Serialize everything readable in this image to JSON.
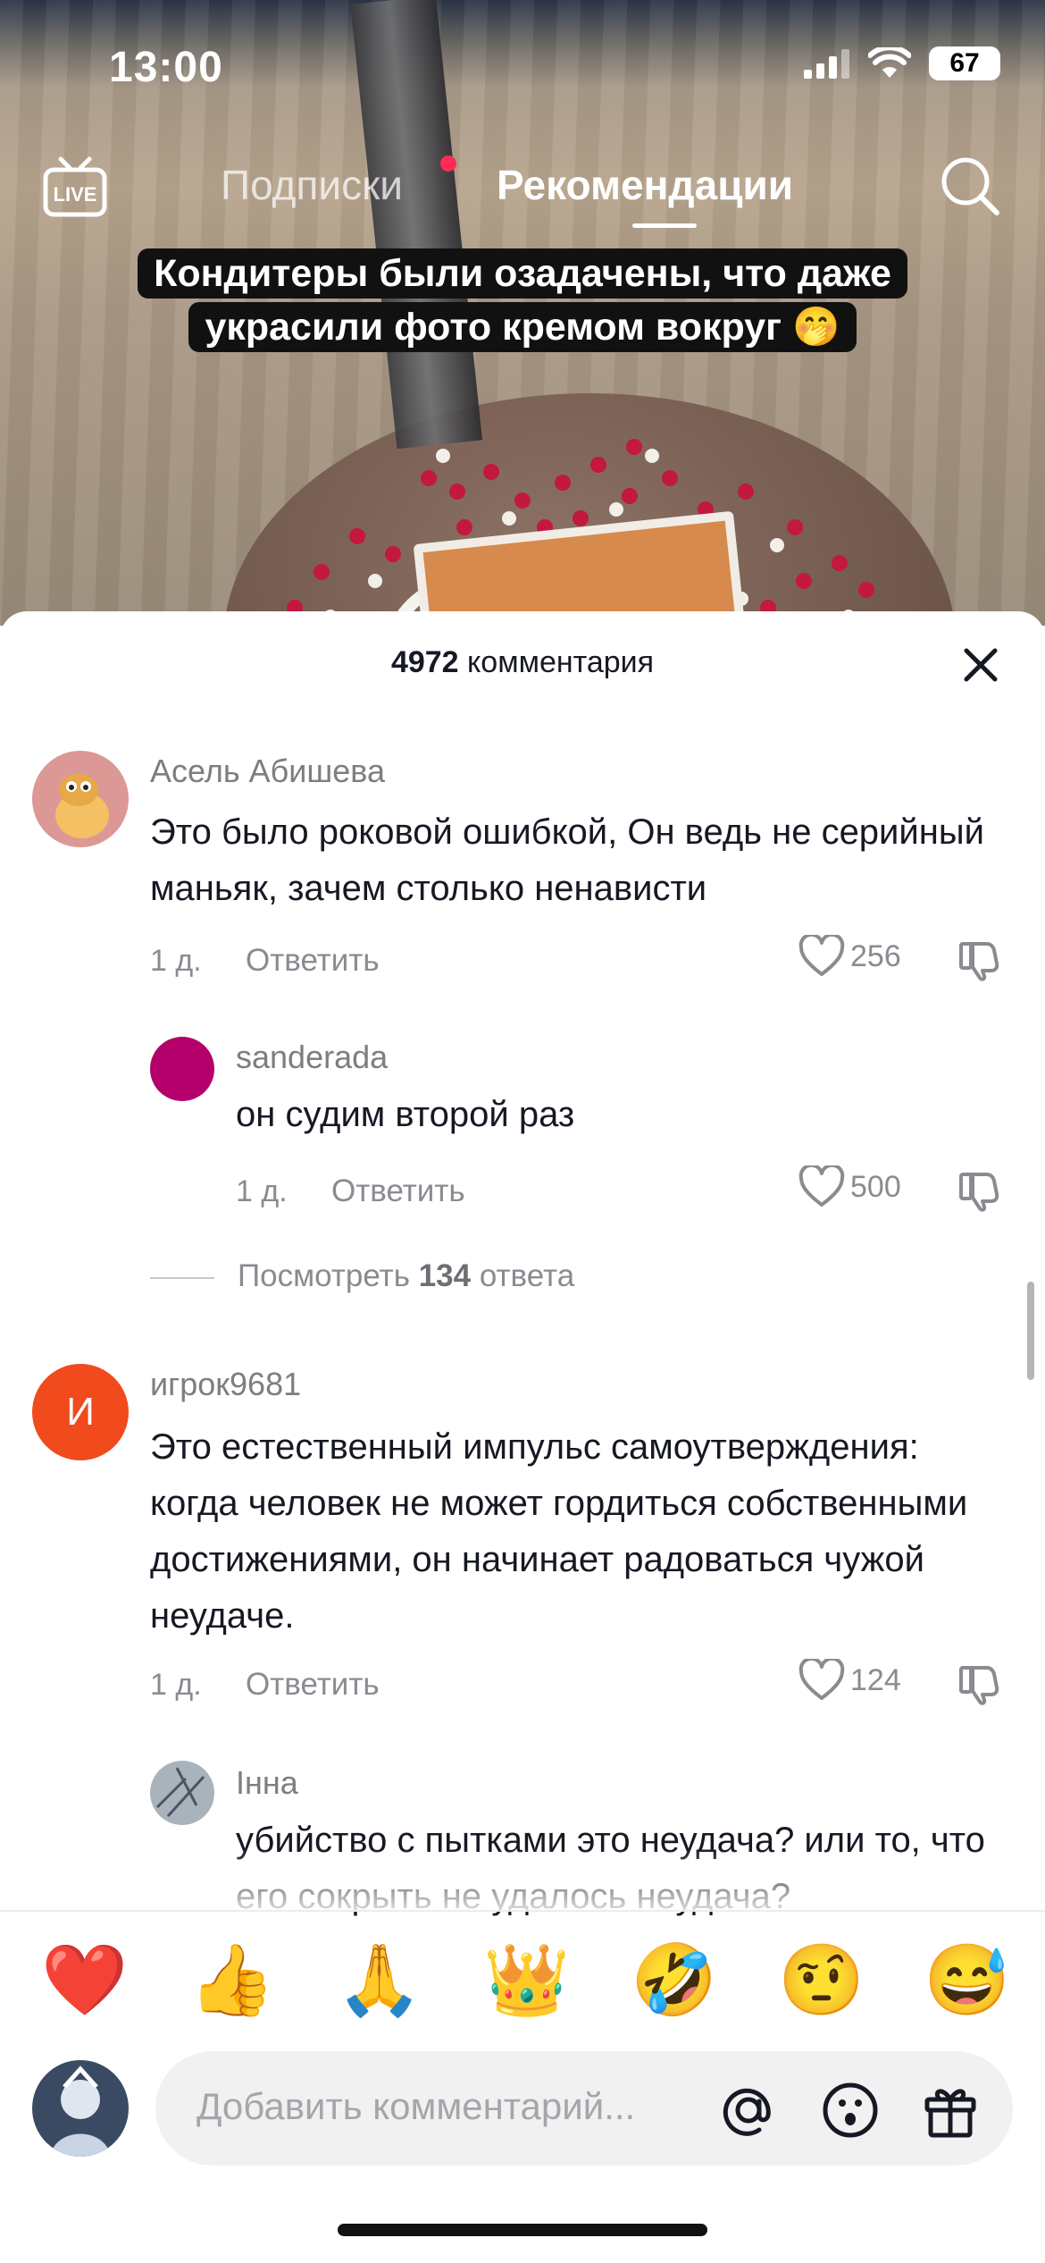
{
  "status_bar": {
    "time": "13:00",
    "battery": "67"
  },
  "top_nav": {
    "live_label": "LIVE",
    "tab_subscriptions": "Подписки",
    "tab_recommendations": "Рекомендации"
  },
  "video": {
    "caption_line1": "Кондитеры были озадачены, что даже",
    "caption_line2": "украсили фото кремом вокруг 🤭"
  },
  "comments_sheet": {
    "count": "4972",
    "count_label": "комментария",
    "comments": [
      {
        "username": "Асель Абишева",
        "text": "Это было роковой ошибкой, Он ведь не серийный маньяк, зачем столько ненависти",
        "time": "1 д.",
        "reply_label": "Ответить",
        "likes": "256"
      },
      {
        "username": "sanderada",
        "text": "он судим второй раз",
        "time": "1 д.",
        "reply_label": "Ответить",
        "likes": "500"
      },
      {
        "username": "игрок9681",
        "avatar_letter": "И",
        "text": "Это естественный импульс самоутверждения: когда человек не может гордиться собственными достижениями, он начинает радоваться чужой неудаче.",
        "time": "1 д.",
        "reply_label": "Ответить",
        "likes": "124"
      },
      {
        "username": "Інна",
        "text": "убийство с пытками это неудача? или то, что его сокрыть не удалось неудача?"
      }
    ],
    "view_replies_prefix": "Посмотреть",
    "view_replies_count": "134",
    "view_replies_suffix": "ответа"
  },
  "quick_emojis": [
    "❤️",
    "👍",
    "🙏",
    "👑",
    "🤣",
    "🤨",
    "😅"
  ],
  "composer": {
    "placeholder": "Добавить комментарий..."
  },
  "colors": {
    "accent_red": "#fe2c55",
    "avatar_orange": "#f04a1d",
    "avatar_magenta": "#b3006a"
  }
}
